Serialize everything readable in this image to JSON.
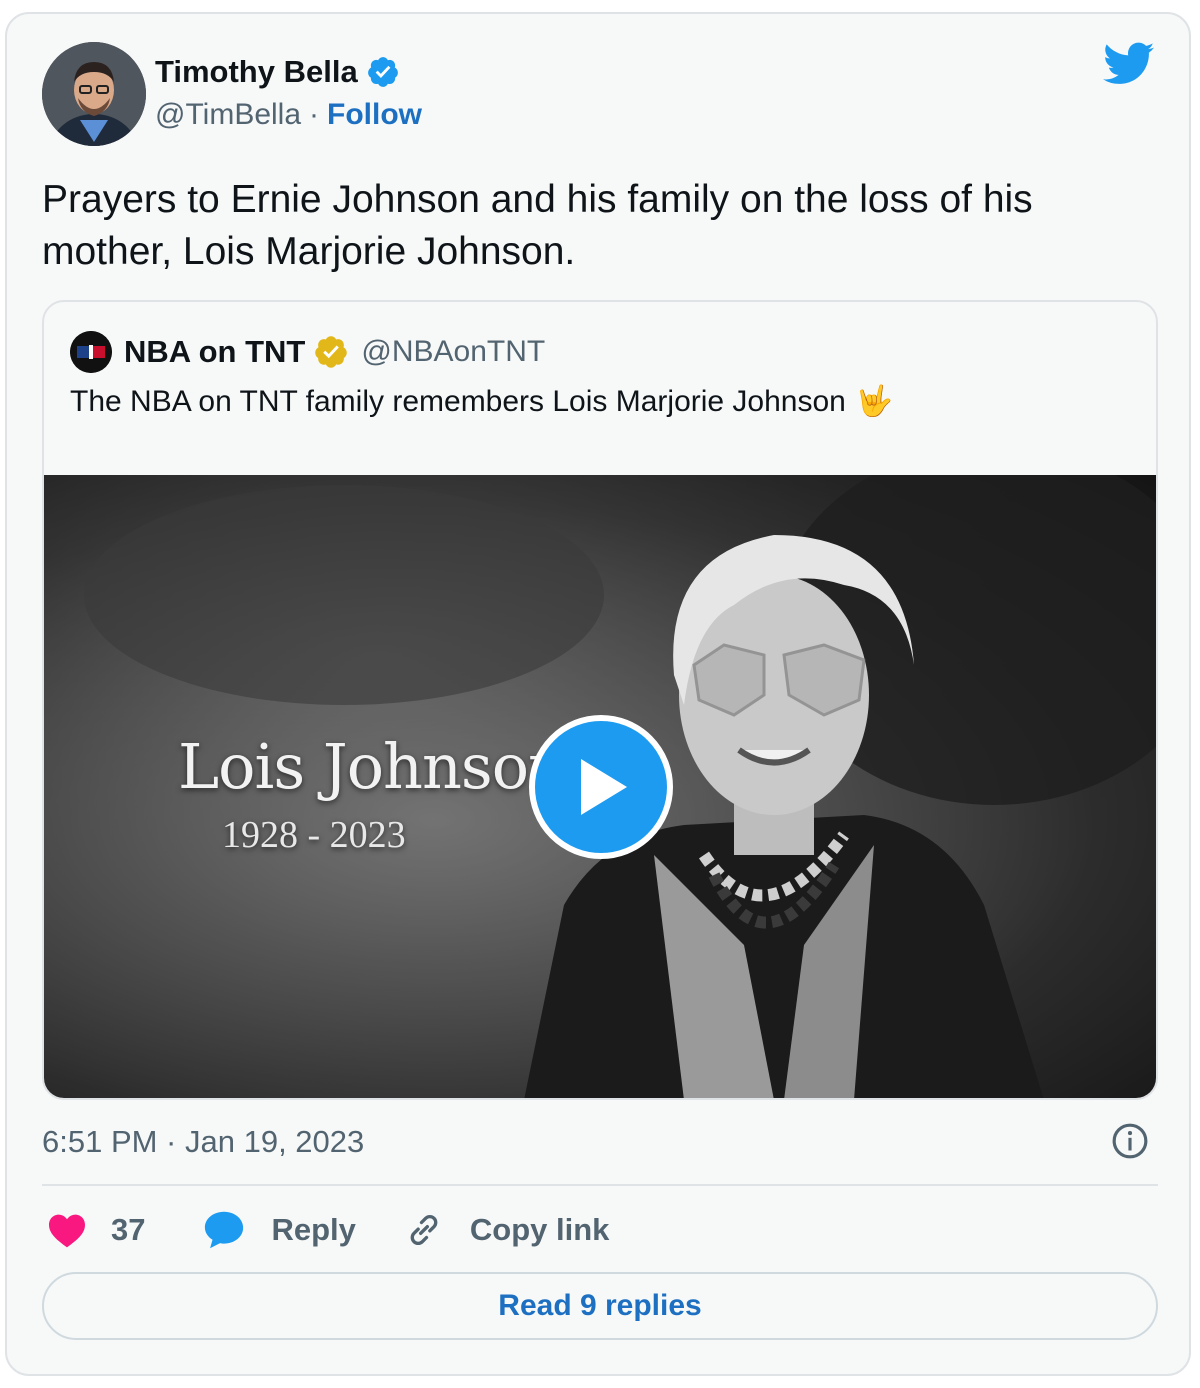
{
  "author": {
    "name": "Timothy Bella",
    "handle": "@TimBella",
    "separator": "·",
    "follow_label": "Follow",
    "verified_color": "#1d9bf0"
  },
  "tweet": {
    "text": "Prayers to Ernie Johnson and his family on the loss of his mother, Lois Marjorie Johnson.",
    "timestamp": "6:51 PM · Jan 19, 2023"
  },
  "quoted": {
    "name": "NBA on TNT",
    "handle": "@NBAonTNT",
    "text": "The NBA on TNT family remembers Lois Marjorie Johnson",
    "emoji": "🤟",
    "badge_color": "#e2b719",
    "media": {
      "title": "Lois Johnson",
      "years": "1928 - 2023"
    }
  },
  "actions": {
    "like_count": "37",
    "reply_label": "Reply",
    "copy_label": "Copy link",
    "like_color": "#f91880",
    "reply_color": "#1d9bf0"
  },
  "read_replies_label": "Read 9 replies",
  "icons": {
    "brand": "twitter-bird-icon",
    "like": "heart-icon",
    "reply": "speech-bubble-icon",
    "copy": "link-icon",
    "info": "info-icon",
    "play": "play-icon"
  },
  "accent": "#1d9bf0"
}
